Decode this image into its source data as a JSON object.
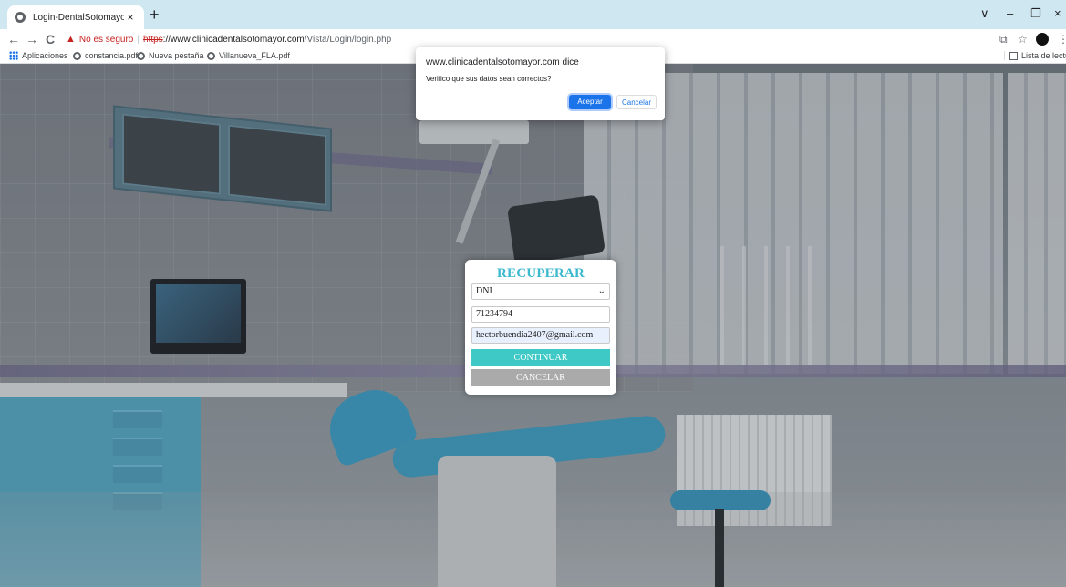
{
  "browser": {
    "tab_title": "Login-DentalSotomayor",
    "tab_close": "×",
    "new_tab": "+",
    "window_controls": {
      "collapse": "∨",
      "minimize": "–",
      "maximize": "❐",
      "close": "×"
    },
    "nav": {
      "back": "←",
      "forward": "→",
      "reload": "C"
    },
    "security_warning": "No es seguro",
    "url_scheme": "https",
    "url_host": "://www.clinicadentalsotomayor.com",
    "url_path": "/Vista/Login/login.php",
    "toolbar_icons": {
      "share": "⧉",
      "star": "☆",
      "menu": "⋮"
    },
    "bookmarks": [
      {
        "label": "Aplicaciones",
        "icon": "apps-grid-icon"
      },
      {
        "label": "constancia.pdf",
        "icon": "globe-icon"
      },
      {
        "label": "Nueva pestaña",
        "icon": "globe-icon"
      },
      {
        "label": "Villanueva_FLA.pdf",
        "icon": "globe-icon"
      }
    ],
    "reading_list": "Lista de lectura"
  },
  "dialog": {
    "title": "www.clinicadentalsotomayor.com dice",
    "message": "Verifico que sus datos sean correctos?",
    "ok_label": "Aceptar",
    "cancel_label": "Cancelar"
  },
  "form": {
    "title": "RECUPERAR",
    "doc_type_selected": "DNI",
    "doc_number": "71234794",
    "email": "hectorbuendia2407@gmail.com",
    "continue_label": "CONTINUAR",
    "cancel_label": "CANCELAR"
  },
  "colors": {
    "accent": "#3cb8cf",
    "continue_button": "#3ec9c6",
    "cancel_button": "#aaaaaa",
    "dialog_primary": "#1a73e8",
    "warning": "#c5221f"
  }
}
